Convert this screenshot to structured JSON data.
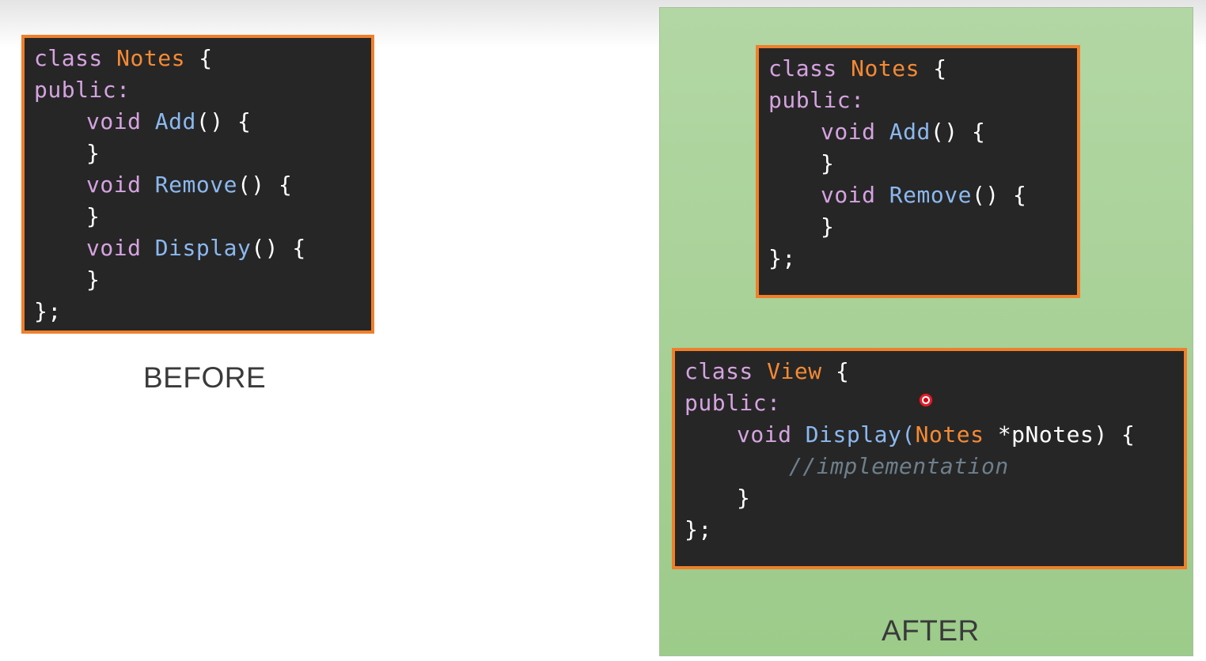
{
  "before": {
    "caption": "BEFORE",
    "code": {
      "class_kw": "class",
      "class_name": "Notes",
      "open_brace": " {",
      "access": "public:",
      "methods": [
        {
          "ret": "void",
          "name": "Add",
          "rest": "() {",
          "close": "}"
        },
        {
          "ret": "void",
          "name": "Remove",
          "rest": "() {",
          "close": "}"
        },
        {
          "ret": "void",
          "name": "Display",
          "rest": "() {",
          "close": "}"
        }
      ],
      "end": "};"
    }
  },
  "after": {
    "caption": "AFTER",
    "notes_code": {
      "class_kw": "class",
      "class_name": "Notes",
      "open_brace": " {",
      "access": "public:",
      "methods": [
        {
          "ret": "void",
          "name": "Add",
          "rest": "() {",
          "close": "}"
        },
        {
          "ret": "void",
          "name": "Remove",
          "rest": "() {",
          "close": "}"
        }
      ],
      "end": "};"
    },
    "view_code": {
      "class_kw": "class",
      "class_name": "View",
      "open_brace": " {",
      "access": "public:",
      "method": {
        "ret": "void",
        "name": "Display",
        "paren_open": "(",
        "param_type": "Notes",
        "param_rest": " *pNotes) {",
        "comment": "//implementation",
        "close": "}"
      },
      "end": "};"
    }
  },
  "colors": {
    "keyword": "#d5a3e0",
    "class_name": "#f58a34",
    "function": "#8bb8ef",
    "comment": "#6e7f8c",
    "box_border": "#f07f2b",
    "box_bg": "#262626",
    "panel_green": "#a9d39a"
  }
}
